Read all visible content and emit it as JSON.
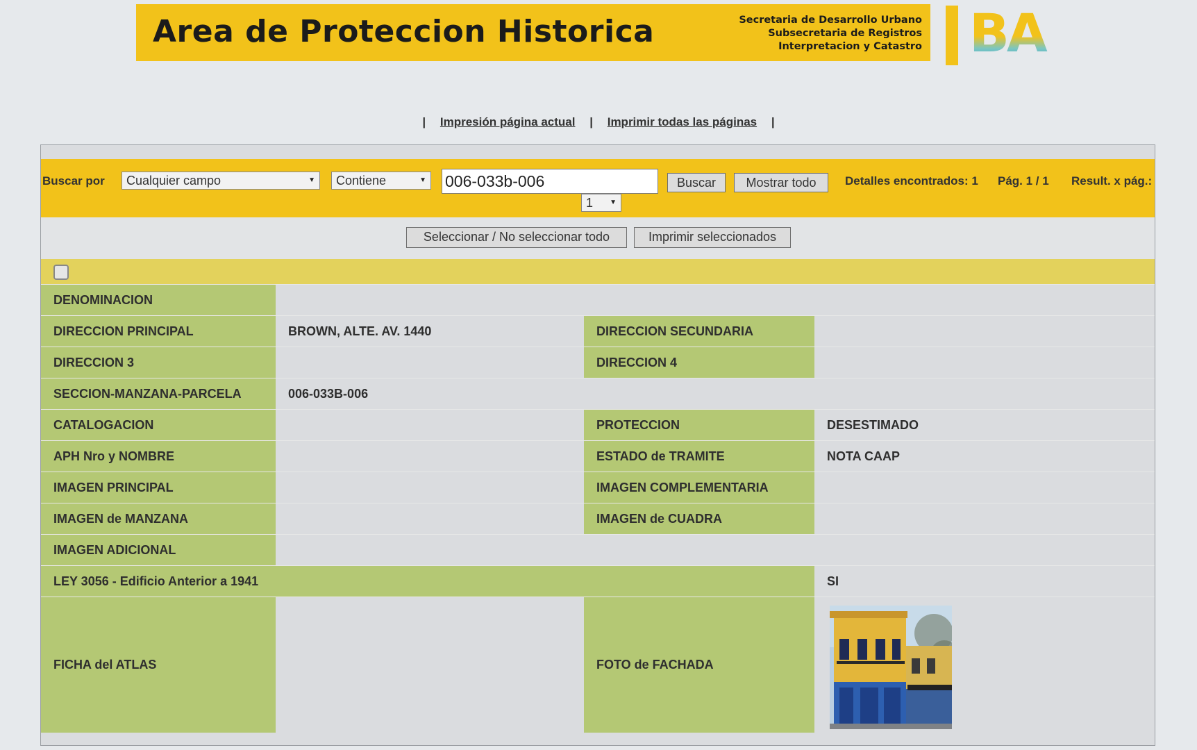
{
  "header": {
    "title": "Area de Proteccion Historica",
    "org": [
      "Secretaria de Desarrollo Urbano",
      "Subsecretaria de Registros",
      "Interpretacion y Catastro"
    ],
    "logo_text": "BA"
  },
  "print_links": {
    "current_page": "Impresión página actual",
    "all_pages": "Imprimir todas las páginas",
    "separator": "|"
  },
  "search": {
    "label": "Buscar por",
    "field_select": "Cualquier campo",
    "operator_select": "Contiene",
    "query": "006-033b-006",
    "search_button": "Buscar",
    "show_all_button": "Mostrar todo",
    "found": "Detalles encontrados: 1",
    "page": "Pág. 1 / 1",
    "results_per_page_label": "Result. x pág.:",
    "results_per_page_value": "1"
  },
  "actions": {
    "select_all": "Seleccionar / No seleccionar todo",
    "print_selected": "Imprimir seleccionados"
  },
  "record": {
    "denominacion_label": "DENOMINACION",
    "denominacion": "",
    "direccion_principal_label": "DIRECCION PRINCIPAL",
    "direccion_principal": "BROWN, ALTE. AV. 1440",
    "direccion_secundaria_label": "DIRECCION SECUNDARIA",
    "direccion_secundaria": "",
    "direccion_3_label": "DIRECCION 3",
    "direccion_3": "",
    "direccion_4_label": "DIRECCION 4",
    "direccion_4": "",
    "smp_label": "SECCION-MANZANA-PARCELA",
    "smp": "006-033B-006",
    "catalogacion_label": "CATALOGACION",
    "catalogacion": "",
    "proteccion_label": "PROTECCION",
    "proteccion": "DESESTIMADO",
    "aph_label": "APH Nro y NOMBRE",
    "aph": "",
    "estado_label": "ESTADO de TRAMITE",
    "estado": "NOTA CAAP",
    "imagen_principal_label": "IMAGEN PRINCIPAL",
    "imagen_complementaria_label": "IMAGEN COMPLEMENTARIA",
    "imagen_manzana_label": "IMAGEN de MANZANA",
    "imagen_cuadra_label": "IMAGEN de CUADRA",
    "imagen_adicional_label": "IMAGEN ADICIONAL",
    "ley_label": "LEY 3056 - Edificio Anterior a 1941",
    "ley": "SI",
    "ficha_label": "FICHA del ATLAS",
    "foto_label": "FOTO de FACHADA"
  },
  "colors": {
    "brand_yellow": "#f2c21a",
    "label_green": "#b4c874",
    "strip_yellow": "#e3d25c"
  }
}
